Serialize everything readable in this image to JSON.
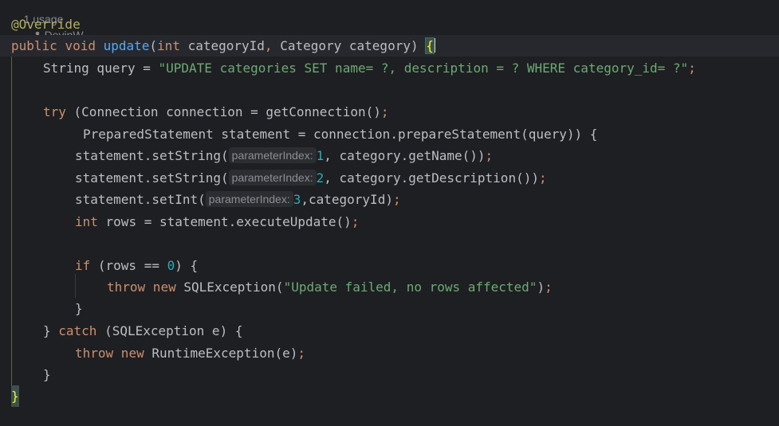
{
  "inlay": {
    "usages": "1 usage",
    "author": "DevinW"
  },
  "code": {
    "annotation": "@Override",
    "signature": {
      "kw_public": "public",
      "kw_void": "void",
      "method_name": "update",
      "paren_open": "(",
      "kw_int": "int",
      "param1": " categoryId",
      "comma": ",",
      "param2_type": " Category",
      "param2": " category",
      "paren_close": ")",
      "brace_open": "{"
    },
    "query_line": {
      "type": "String",
      "var": " query = ",
      "value": "\"UPDATE categories SET name= ?, description = ? WHERE category_id= ?\"",
      "semi": ";"
    },
    "try_line": {
      "kw_try": "try",
      "rest": " (Connection connection = getConnection()",
      "semi": ";"
    },
    "prepared_line": {
      "text": "PreparedStatement statement = connection.prepareStatement(query)) {"
    },
    "set_name_line": {
      "prefix": "statement.setString(",
      "hint": "parameterIndex:",
      "index": "1",
      "rest": ", category.getName())",
      "semi": ";"
    },
    "set_desc_line": {
      "prefix": "statement.setString(",
      "hint": "parameterIndex:",
      "index": "2",
      "rest": ", category.getDescription())",
      "semi": ";"
    },
    "set_int_line": {
      "prefix": "statement.setInt(",
      "hint": "parameterIndex:",
      "index": "3",
      "rest": ",categoryId)",
      "semi": ";"
    },
    "rows_line": {
      "kw_int": "int",
      "rest": " rows = statement.executeUpdate()",
      "semi": ";"
    },
    "if_line": {
      "kw_if": "if",
      "rest_a": " (rows == ",
      "zero": "0",
      "rest_b": ") {"
    },
    "throw_sql_line": {
      "kw_throw": "throw",
      "kw_new": " new",
      "cls": " SQLException(",
      "msg": "\"Update failed, no rows affected\"",
      "close": ")",
      "semi": ";"
    },
    "if_close": "}",
    "catch_line": {
      "open": "} ",
      "kw_catch": "catch",
      "rest": " (SQLException e) {"
    },
    "throw_rt_line": {
      "kw_throw": "throw",
      "kw_new": " new",
      "rest": " RuntimeException(e)",
      "semi": ";"
    },
    "try_close": "}",
    "method_close": "}"
  }
}
